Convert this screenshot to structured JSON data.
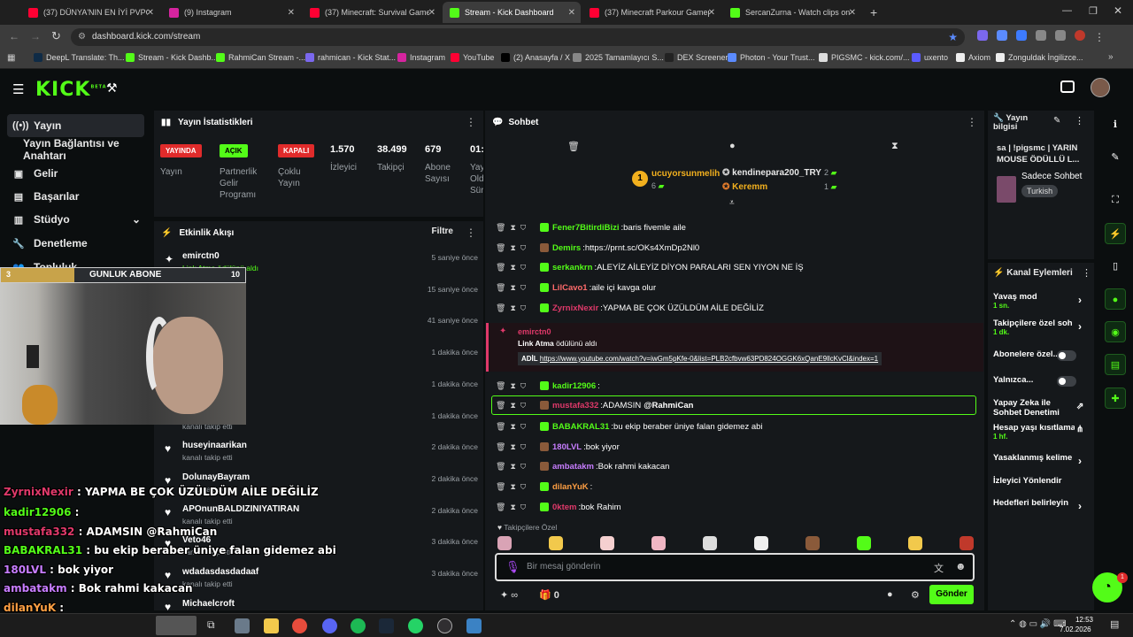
{
  "browser": {
    "tabs": [
      {
        "label": "(37) DÜNYA'NIN EN İYİ PVPCİSİ",
        "color": "#ff0033"
      },
      {
        "label": "(9) Instagram",
        "color": "#d6249f"
      },
      {
        "label": "(37) Minecraft: Survival Gamesi",
        "color": "#ff0033"
      },
      {
        "label": "Stream - Kick Dashboard",
        "color": "#53fc18"
      },
      {
        "label": "(37) Minecraft Parkour Gamepl",
        "color": "#ff0033"
      },
      {
        "label": "SercanZurna - Watch clips on K",
        "color": "#53fc18"
      }
    ],
    "url": "dashboard.kick.com/stream",
    "bookmarks": [
      "DeepL Translate: Th...",
      "Stream - Kick Dashb...",
      "RahmiCan Stream -...",
      "rahmican - Kick Stat...",
      "Instagram",
      "YouTube",
      "(2) Anasayfa / X",
      "2025 Tamamlayıcı S...",
      "DEX Screener",
      "Photon - Your Trust...",
      "PIGSMC - kick.com/...",
      "uxento",
      "Axiom",
      "Zonguldak İngilizce..."
    ]
  },
  "kick": {
    "logo": "KICK",
    "logo_sup": "BETA",
    "accent": "#53fc18"
  },
  "nav": {
    "items": [
      {
        "label": "Yayın",
        "icon": "broadcast-icon"
      },
      {
        "label": "Yayın Bağlantısı ve Anahtarı",
        "icon": ""
      },
      {
        "label": "Gelir",
        "icon": "dollar-icon"
      },
      {
        "label": "Başarılar",
        "icon": "trophy-icon"
      },
      {
        "label": "Stüdyo",
        "icon": "studio-icon"
      },
      {
        "label": "Denetleme",
        "icon": "wrench-icon"
      },
      {
        "label": "Topluluk",
        "icon": "people-icon"
      }
    ]
  },
  "stats": {
    "title": "Yayın İstatistikleri",
    "items": [
      {
        "pill": "YAYINDA",
        "label": "Yayın"
      },
      {
        "pill": "AÇIK",
        "label": "Partnerlik Gelir Programı"
      },
      {
        "pill": "KAPALI",
        "label": "Çoklu Yayın"
      },
      {
        "value": "1.570",
        "label": "İzleyici"
      },
      {
        "value": "38.499",
        "label": "Takipçi"
      },
      {
        "value": "679",
        "label": "Abone Sayısı"
      },
      {
        "value": "01:",
        "label": "Yay Old Sür"
      }
    ]
  },
  "activity": {
    "title": "Etkinlik Akışı",
    "filter": "Filtre",
    "items": [
      {
        "name": "emirctn0",
        "sub": "Link Atma ödülünü aldı",
        "time": "5 saniye önce"
      },
      {
        "name": "",
        "sub": "",
        "time": "15 saniye önce"
      },
      {
        "name": "",
        "sub": "",
        "time": "41 saniye önce"
      },
      {
        "name": "",
        "sub": "",
        "time": "1 dakika önce"
      },
      {
        "name": "",
        "sub": "",
        "time": "1 dakika önce"
      },
      {
        "name": "",
        "sub": "kanalı takip etti",
        "time": "1 dakika önce"
      },
      {
        "name": "huseyinaarikan",
        "sub": "kanalı takip etti",
        "time": "2 dakika önce"
      },
      {
        "name": "DolunayBayram",
        "sub": "kanalı takip etti",
        "time": "2 dakika önce"
      },
      {
        "name": "APOnunBALDIZINIYATIRAN",
        "sub": "kanalı takip etti",
        "time": "2 dakika önce"
      },
      {
        "name": "Veto46",
        "sub": "kanalı takip etti",
        "time": "3 dakika önce"
      },
      {
        "name": "wdadasdasdadaaf",
        "sub": "kanalı takip etti",
        "time": "3 dakika önce"
      },
      {
        "name": "Michaelcroft",
        "sub": "",
        "time": ""
      }
    ]
  },
  "chat": {
    "title": "Sohbet",
    "leaders": {
      "top_name": "ucuyorsunmelih",
      "top_count": "6",
      "top_rank": "1",
      "second_name": "kendinepara200_TRY",
      "second_count": "2",
      "third_name": "Keremm",
      "third_count": "1"
    },
    "messages": [
      {
        "user": "Fener7BitirdiBizi",
        "color": "#53fc18",
        "text": "baris fivemle aile"
      },
      {
        "user": "Demirs",
        "color": "#53fc18",
        "text": "https://prnt.sc/OKs4XmDp2Nl0"
      },
      {
        "user": "serkankrn",
        "color": "#53fc18",
        "text": "ALEYİZ AİLEYİZ DİYON PARALARI SEN YIYON NE İŞ"
      },
      {
        "user": "LilCavo1",
        "color": "#ff6b6b",
        "text": "aile içi kavga olur"
      },
      {
        "user": "ZyrnixNexir",
        "color": "#e0396a",
        "text": "YAPMA BE ÇOK ÜZÜLDÜM AİLE DEĞİLİZ"
      }
    ],
    "reward": {
      "user": "emirctn0",
      "reward_name": "Link Atma",
      "reward_text": "ödülünü aldı",
      "prefix": "ADİL",
      "link": "https://www.youtube.com/watch?v=iwGm5pKfe-0&list=PLB2cfbvw63PD824OGGK6xQanE9llcKvCl&index=1"
    },
    "messages2": [
      {
        "user": "kadir12906",
        "color": "#53fc18",
        "text": ""
      },
      {
        "user": "mustafa332",
        "color": "#e0396a",
        "text": "ADAMSIN",
        "mention": "@RahmiCan"
      },
      {
        "user": "BABAKRAL31",
        "color": "#53fc18",
        "text": "bu ekip beraber üniye falan gidemez abi"
      },
      {
        "user": "180LVL",
        "color": "#c77dff",
        "text": "bok yiyor"
      },
      {
        "user": "ambatakm",
        "color": "#c77dff",
        "text": "Bok rahmi kakacan"
      },
      {
        "user": "dilanYuK",
        "color": "#ff9f43",
        "text": ""
      },
      {
        "user": "0ktem",
        "color": "#e0396a",
        "text": "bok Rahim"
      }
    ],
    "emote_label": "Takipçilere Özel",
    "input_placeholder": "Bir mesaj gönderin",
    "infinity_count": "∞",
    "gift_count": "0",
    "send_label": "Gönder"
  },
  "stream_info": {
    "title": "Yayın bilgisi",
    "stream_title": "sa | !pigsmc | YARIN MOUSE ÖDÜLLÜ L...",
    "chat_mode": "Sadece Sohbet",
    "language": "Turkish"
  },
  "channel_actions": {
    "title": "Kanal Eylemleri",
    "items": [
      {
        "label": "Yavaş mod",
        "sub": "1 sn."
      },
      {
        "label": "Takipçilere özel soh",
        "sub": "1 dk."
      },
      {
        "label": "Abonelere özel...",
        "sub": ""
      },
      {
        "label": "Yalnızca...",
        "sub": ""
      },
      {
        "label": "Yapay Zeka ile Sohbet Denetimi",
        "sub": ""
      },
      {
        "label": "Hesap yaşı kısıtlama",
        "sub": "1 hf."
      },
      {
        "label": "Yasaklanmış kelime",
        "sub": ""
      },
      {
        "label": "İzleyici Yönlendir",
        "sub": ""
      },
      {
        "label": "Hedefleri belirleyin",
        "sub": ""
      }
    ]
  },
  "overlay": {
    "sub_goal_current": "3",
    "sub_goal_label": "GUNLUK ABONE",
    "sub_goal_target": "10",
    "sub_goal_progress": 0.3,
    "chat_lines": [
      {
        "user": "ZyrnixNexir",
        "color": "#e0396a",
        "text": "YAPMA BE ÇOK ÜZÜLDÜM AİLE DEĞİLİZ"
      },
      {
        "user": "kadir12906",
        "color": "#53fc18",
        "text": ""
      },
      {
        "user": "mustafa332",
        "color": "#e0396a",
        "text": "ADAMSIN @RahmiCan"
      },
      {
        "user": "BABAKRAL31",
        "color": "#53fc18",
        "text": "bu ekip beraber üniye falan gidemez abi"
      },
      {
        "user": "180LVL",
        "color": "#c77dff",
        "text": "bok yiyor"
      },
      {
        "user": "ambatakm",
        "color": "#c77dff",
        "text": "Bok rahmi kakacan"
      },
      {
        "user": "dilanYuK",
        "color": "#ff9f43",
        "text": ""
      },
      {
        "user": "0ktem",
        "color": "#e0396a",
        "text": "bok Rahim"
      }
    ]
  },
  "taskbar": {
    "time": "12:53",
    "date": "7.02.2026"
  }
}
